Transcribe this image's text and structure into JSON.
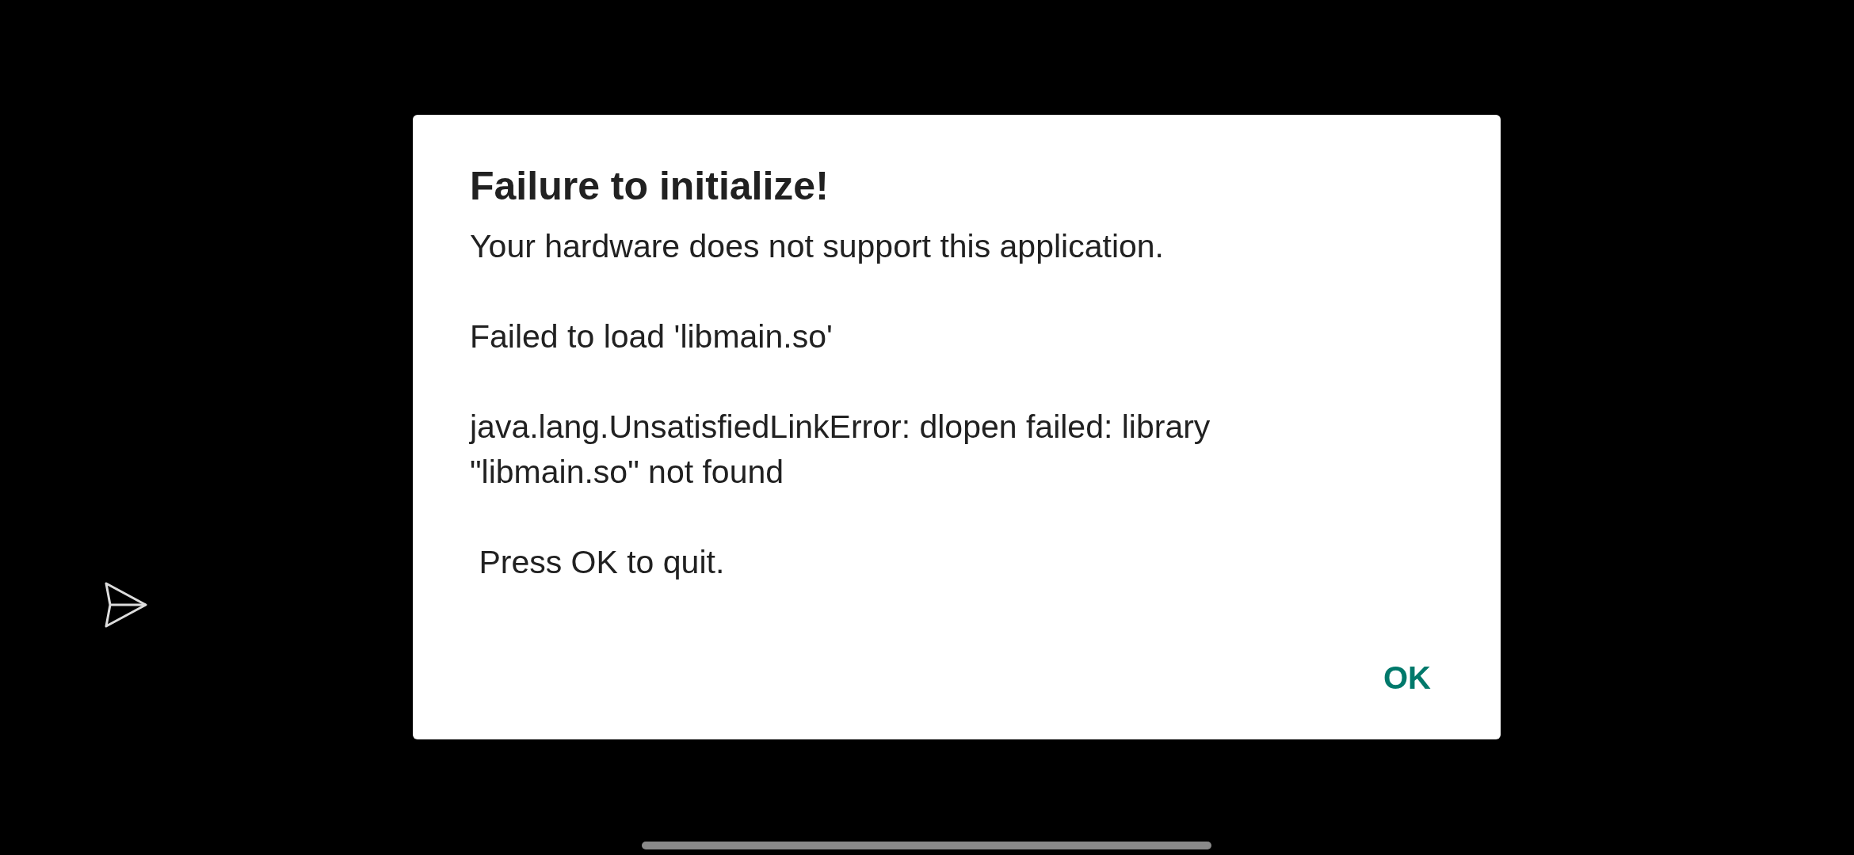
{
  "dialog": {
    "title": "Failure to initialize!",
    "message": "Your hardware does not support this application.\n\nFailed to load 'libmain.so'\n\njava.lang.UnsatisfiedLinkError: dlopen failed: library \"libmain.so\" not found\n\n Press OK to quit.",
    "buttons": [
      "OK"
    ]
  }
}
